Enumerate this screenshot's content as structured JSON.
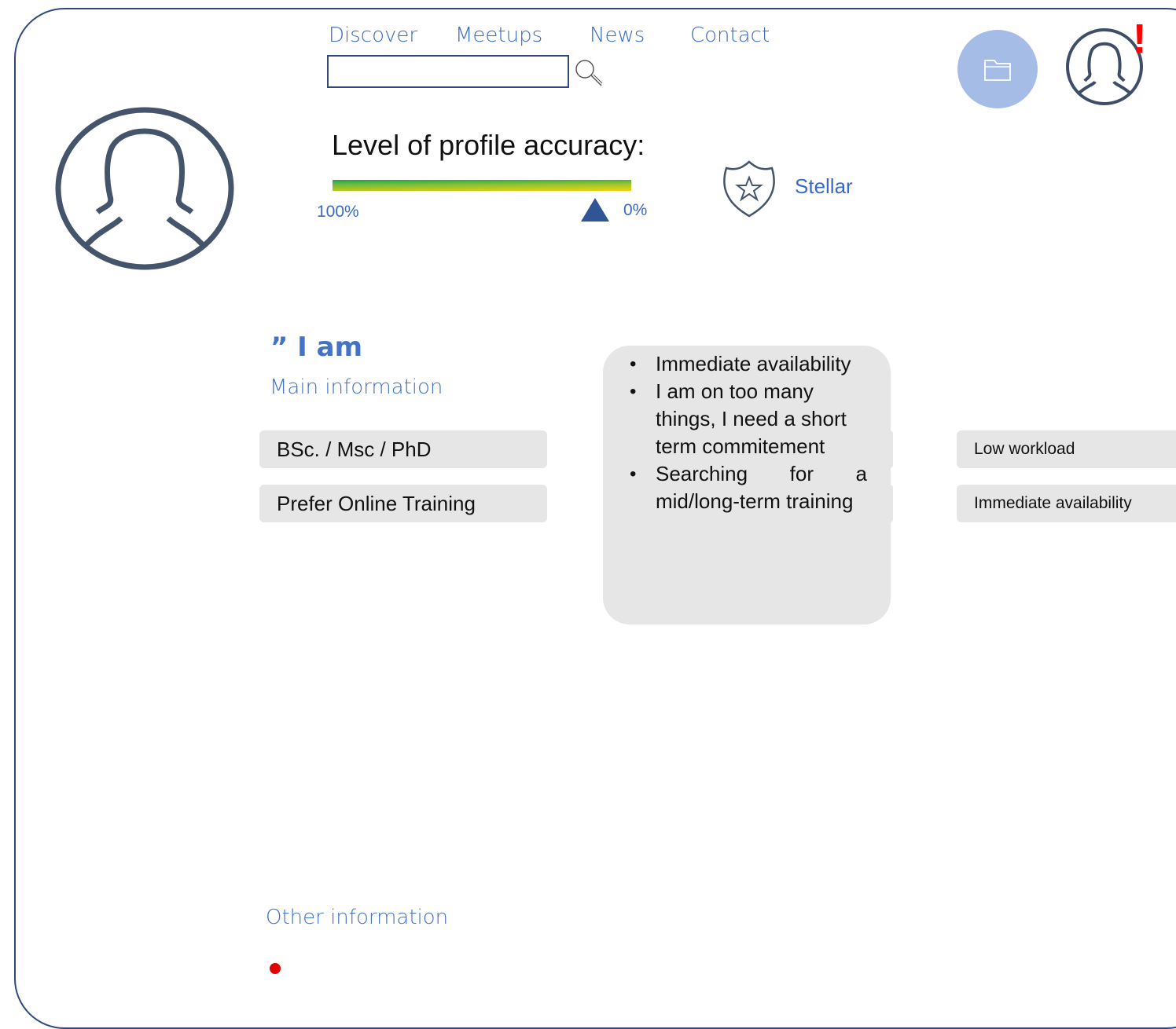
{
  "nav": {
    "items": [
      {
        "label": "Discover"
      },
      {
        "label": "Meetups"
      },
      {
        "label": "News"
      },
      {
        "label": "Contact"
      }
    ]
  },
  "search": {
    "placeholder": "",
    "value": ""
  },
  "profile_accuracy": {
    "title": "Level of profile accuracy:",
    "left_label": "100%",
    "right_label": "0%",
    "indicator_value_percent": 12
  },
  "badge": {
    "icon": "star-shield-icon",
    "label": "Stellar"
  },
  "quote": {
    "text": "” I am"
  },
  "main_info": {
    "label": "Main information",
    "chips": [
      "BSc. / Msc / PhD",
      "Prefer Online Training"
    ]
  },
  "bubble": {
    "items": [
      "Immediate availability",
      "I am on too many things, I need a short term commitement",
      "Searching for a mid/long-term training"
    ]
  },
  "right_chips": [
    "Low workload",
    "Immediate availability"
  ],
  "other_info": {
    "label": "Other information"
  },
  "header_icons": {
    "folder": "folder-icon",
    "user": "user-icon",
    "alert": "!"
  },
  "colors": {
    "accent": "#4472c4",
    "border": "#2f4a7a",
    "chip_bg": "#e6e6e6",
    "alert": "#ff0000"
  }
}
